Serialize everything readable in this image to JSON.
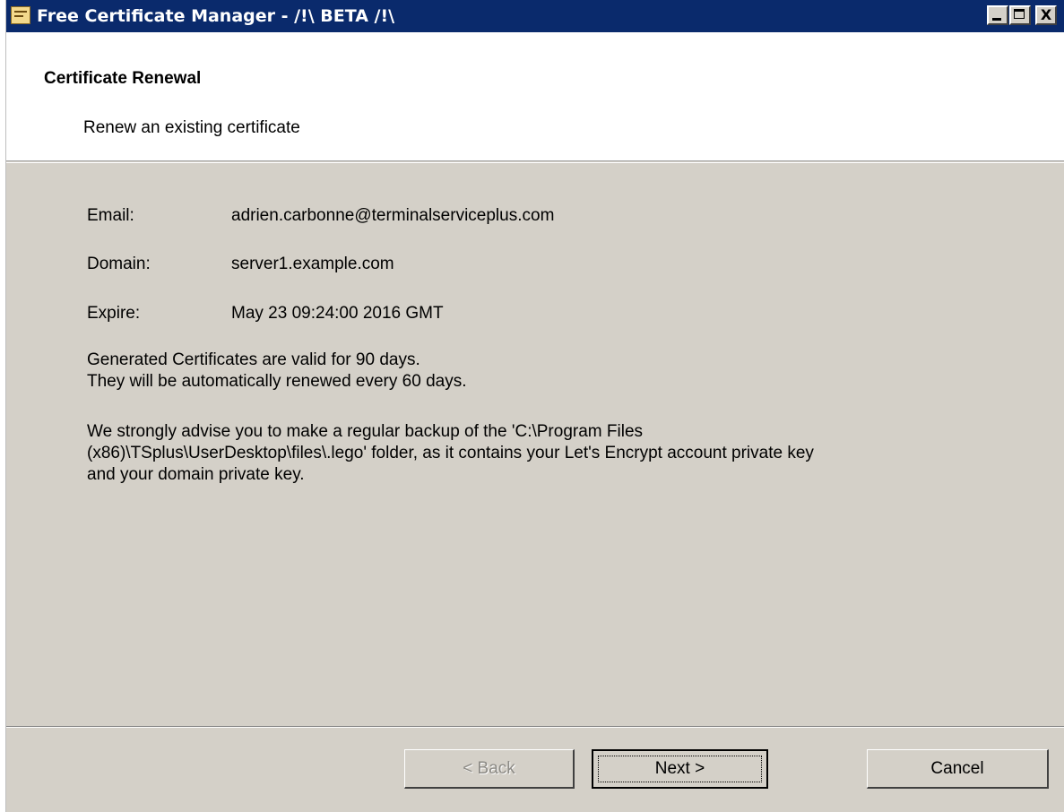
{
  "window": {
    "title": "Free Certificate Manager - /!\\ BETA /!\\",
    "controls": [
      "minimize",
      "maximize",
      "close"
    ],
    "close_glyph": "X"
  },
  "header": {
    "title": "Certificate Renewal",
    "subtitle": "Renew an existing certificate"
  },
  "details": {
    "email_label": "Email:",
    "email_value": "adrien.carbonne@terminalserviceplus.com",
    "domain_label": "Domain:",
    "domain_value": "server1.example.com",
    "expire_label": "Expire:",
    "expire_value": "May 23 09:24:00 2016 GMT"
  },
  "info": {
    "line1": "Generated Certificates are valid for 90 days.",
    "line2": "They will be automatically renewed every 60 days.",
    "backup_line1": "We strongly advise you to make a regular backup of the 'C:\\Program Files",
    "backup_line2": "(x86)\\TSplus\\UserDesktop\\files\\.lego' folder, as it contains your Let's Encrypt account private key",
    "backup_line3": "and your domain private key."
  },
  "buttons": {
    "back": "< Back",
    "next": "Next >",
    "cancel": "Cancel"
  },
  "colors": {
    "titlebar": "#0a2a6c",
    "dialog_bg": "#d4d0c8",
    "header_bg": "#ffffff"
  }
}
